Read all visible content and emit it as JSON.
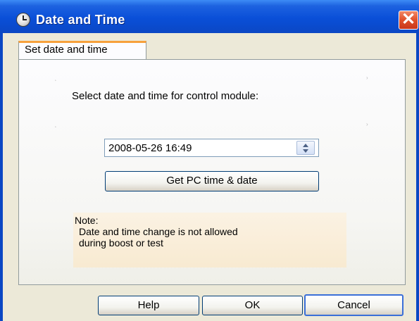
{
  "window": {
    "title": "Date and Time",
    "close_symbol": "✕",
    "icon": "clock-icon"
  },
  "tabs": [
    {
      "label": "Set date and time",
      "selected": true
    }
  ],
  "main": {
    "prompt": "Select date and time for control module:",
    "datetime_value": "2008-05-26 16:49",
    "get_pc_time_label": "Get PC time & date",
    "note": {
      "title": "Note:",
      "line1": "Date and time change is not allowed",
      "line2": "during  boost or test"
    }
  },
  "buttons": {
    "help": "Help",
    "ok": "OK",
    "cancel": "Cancel"
  },
  "colors": {
    "titlebar": "#0b47c4",
    "tab_accent": "#f7a13c",
    "note_background": "#f8ead1",
    "close_button": "#e0502a"
  }
}
